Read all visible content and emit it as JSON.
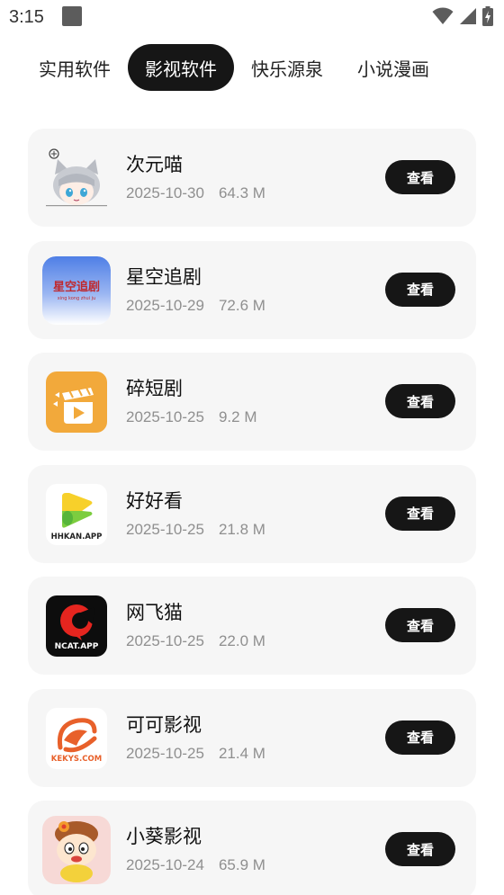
{
  "status_bar": {
    "time": "3:15",
    "icons": [
      "notification-square-icon",
      "wifi-icon",
      "cell-signal-icon",
      "battery-charging-icon"
    ]
  },
  "tabs": [
    {
      "label": "实用软件",
      "active": false
    },
    {
      "label": "影视软件",
      "active": true
    },
    {
      "label": "快乐源泉",
      "active": false
    },
    {
      "label": "小说漫画",
      "active": false
    }
  ],
  "apps": [
    {
      "name": "次元喵",
      "date": "2025-10-30",
      "size": "64.3 M",
      "button": "查看",
      "icon": "anime-cat-girl-icon"
    },
    {
      "name": "星空追剧",
      "date": "2025-10-29",
      "size": "72.6 M",
      "button": "查看",
      "icon": "xingkong-zhuiju-logo-icon",
      "icon_text": "星空追剧",
      "icon_subtext": "xing kong zhui ju"
    },
    {
      "name": "碎短剧",
      "date": "2025-10-25",
      "size": "9.2 M",
      "button": "查看",
      "icon": "clapper-play-icon"
    },
    {
      "name": "好好看",
      "date": "2025-10-25",
      "size": "21.8 M",
      "button": "查看",
      "icon": "hhkan-logo-icon",
      "icon_text": "HHKAN.APP"
    },
    {
      "name": "网飞猫",
      "date": "2025-10-25",
      "size": "22.0 M",
      "button": "查看",
      "icon": "ncat-logo-icon",
      "icon_text": "NCAT.APP"
    },
    {
      "name": "可可影视",
      "date": "2025-10-25",
      "size": "21.4 M",
      "button": "查看",
      "icon": "kekys-logo-icon",
      "icon_text": "KEKYS.COM"
    },
    {
      "name": "小葵影视",
      "date": "2025-10-24",
      "size": "65.9 M",
      "button": "查看",
      "icon": "cartoon-girl-icon"
    }
  ],
  "colors": {
    "accent": "#161616",
    "card_bg": "#f6f6f6",
    "meta_text": "#8f8f8f",
    "ncat_red": "#e5251f",
    "kekys_orange": "#e8602a",
    "clapper_orange": "#f2a93b"
  }
}
